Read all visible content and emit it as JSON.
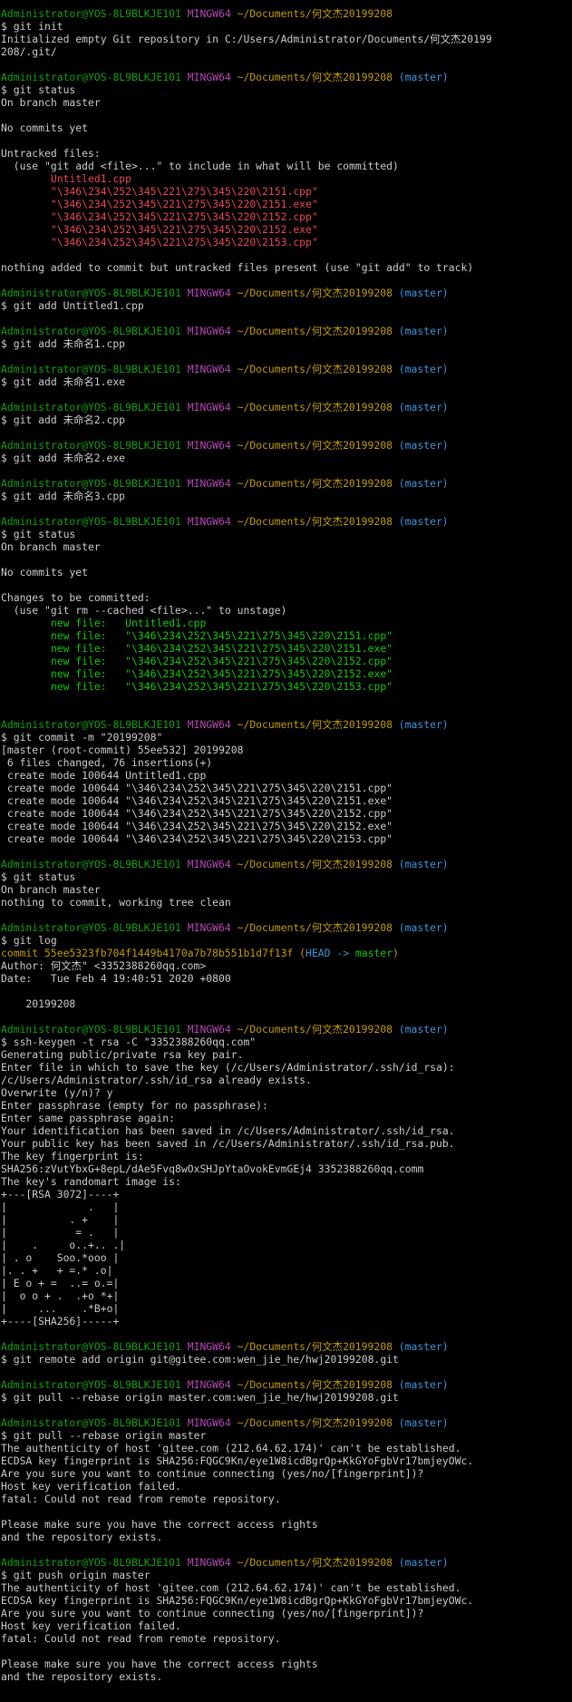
{
  "theme": {
    "background": "#000000",
    "text": "#cccccc",
    "user_host": "#13a10e",
    "mingw": "#b648b6",
    "path": "#c19c00",
    "branch": "#3a96dd",
    "untracked": "#e74856",
    "staged": "#16c60c"
  },
  "lines": [
    [
      [
        "Administrator@YOS-8L9BLKJE101",
        "user"
      ],
      [
        " ",
        "text"
      ],
      [
        "MINGW64",
        "mingw"
      ],
      [
        " ",
        "text"
      ],
      [
        "~/Documents/何文杰20199208",
        "path"
      ]
    ],
    [
      [
        "$ git init",
        "text"
      ]
    ],
    [
      [
        "Initialized empty Git repository in C:/Users/Administrator/Documents/何文杰20199",
        "text"
      ]
    ],
    [
      [
        "208/.git/",
        "text"
      ]
    ],
    [
      [
        "",
        "text"
      ]
    ],
    [
      [
        "Administrator@YOS-8L9BLKJE101",
        "user"
      ],
      [
        " ",
        "text"
      ],
      [
        "MINGW64",
        "mingw"
      ],
      [
        " ",
        "text"
      ],
      [
        "~/Documents/何文杰20199208",
        "path"
      ],
      [
        " ",
        "text"
      ],
      [
        "(master)",
        "branch"
      ]
    ],
    [
      [
        "$ git status",
        "text"
      ]
    ],
    [
      [
        "On branch master",
        "text"
      ]
    ],
    [
      [
        "",
        "text"
      ]
    ],
    [
      [
        "No commits yet",
        "text"
      ]
    ],
    [
      [
        "",
        "text"
      ]
    ],
    [
      [
        "Untracked files:",
        "text"
      ]
    ],
    [
      [
        "  (use \"git add <file>...\" to include in what will be committed)",
        "text"
      ]
    ],
    [
      [
        "        ",
        "text"
      ],
      [
        "Untitled1.cpp",
        "red"
      ]
    ],
    [
      [
        "        ",
        "text"
      ],
      [
        "\"\\346\\234\\252\\345\\221\\275\\345\\220\\2151.cpp\"",
        "red"
      ]
    ],
    [
      [
        "        ",
        "text"
      ],
      [
        "\"\\346\\234\\252\\345\\221\\275\\345\\220\\2151.exe\"",
        "red"
      ]
    ],
    [
      [
        "        ",
        "text"
      ],
      [
        "\"\\346\\234\\252\\345\\221\\275\\345\\220\\2152.cpp\"",
        "red"
      ]
    ],
    [
      [
        "        ",
        "text"
      ],
      [
        "\"\\346\\234\\252\\345\\221\\275\\345\\220\\2152.exe\"",
        "red"
      ]
    ],
    [
      [
        "        ",
        "text"
      ],
      [
        "\"\\346\\234\\252\\345\\221\\275\\345\\220\\2153.cpp\"",
        "red"
      ]
    ],
    [
      [
        "",
        "text"
      ]
    ],
    [
      [
        "nothing added to commit but untracked files present (use \"git add\" to track)",
        "text"
      ]
    ],
    [
      [
        "",
        "text"
      ]
    ],
    [
      [
        "Administrator@YOS-8L9BLKJE101",
        "user"
      ],
      [
        " ",
        "text"
      ],
      [
        "MINGW64",
        "mingw"
      ],
      [
        " ",
        "text"
      ],
      [
        "~/Documents/何文杰20199208",
        "path"
      ],
      [
        " ",
        "text"
      ],
      [
        "(master)",
        "branch"
      ]
    ],
    [
      [
        "$ git add Untitled1.cpp",
        "text"
      ]
    ],
    [
      [
        "",
        "text"
      ]
    ],
    [
      [
        "Administrator@YOS-8L9BLKJE101",
        "user"
      ],
      [
        " ",
        "text"
      ],
      [
        "MINGW64",
        "mingw"
      ],
      [
        " ",
        "text"
      ],
      [
        "~/Documents/何文杰20199208",
        "path"
      ],
      [
        " ",
        "text"
      ],
      [
        "(master)",
        "branch"
      ]
    ],
    [
      [
        "$ git add 未命名1.cpp",
        "text"
      ]
    ],
    [
      [
        "",
        "text"
      ]
    ],
    [
      [
        "Administrator@YOS-8L9BLKJE101",
        "user"
      ],
      [
        " ",
        "text"
      ],
      [
        "MINGW64",
        "mingw"
      ],
      [
        " ",
        "text"
      ],
      [
        "~/Documents/何文杰20199208",
        "path"
      ],
      [
        " ",
        "text"
      ],
      [
        "(master)",
        "branch"
      ]
    ],
    [
      [
        "$ git add 未命名1.exe",
        "text"
      ]
    ],
    [
      [
        "",
        "text"
      ]
    ],
    [
      [
        "Administrator@YOS-8L9BLKJE101",
        "user"
      ],
      [
        " ",
        "text"
      ],
      [
        "MINGW64",
        "mingw"
      ],
      [
        " ",
        "text"
      ],
      [
        "~/Documents/何文杰20199208",
        "path"
      ],
      [
        " ",
        "text"
      ],
      [
        "(master)",
        "branch"
      ]
    ],
    [
      [
        "$ git add 未命名2.cpp",
        "text"
      ]
    ],
    [
      [
        "",
        "text"
      ]
    ],
    [
      [
        "Administrator@YOS-8L9BLKJE101",
        "user"
      ],
      [
        " ",
        "text"
      ],
      [
        "MINGW64",
        "mingw"
      ],
      [
        " ",
        "text"
      ],
      [
        "~/Documents/何文杰20199208",
        "path"
      ],
      [
        " ",
        "text"
      ],
      [
        "(master)",
        "branch"
      ]
    ],
    [
      [
        "$ git add 未命名2.exe",
        "text"
      ]
    ],
    [
      [
        "",
        "text"
      ]
    ],
    [
      [
        "Administrator@YOS-8L9BLKJE101",
        "user"
      ],
      [
        " ",
        "text"
      ],
      [
        "MINGW64",
        "mingw"
      ],
      [
        " ",
        "text"
      ],
      [
        "~/Documents/何文杰20199208",
        "path"
      ],
      [
        " ",
        "text"
      ],
      [
        "(master)",
        "branch"
      ]
    ],
    [
      [
        "$ git add 未命名3.cpp",
        "text"
      ]
    ],
    [
      [
        "",
        "text"
      ]
    ],
    [
      [
        "Administrator@YOS-8L9BLKJE101",
        "user"
      ],
      [
        " ",
        "text"
      ],
      [
        "MINGW64",
        "mingw"
      ],
      [
        " ",
        "text"
      ],
      [
        "~/Documents/何文杰20199208",
        "path"
      ],
      [
        " ",
        "text"
      ],
      [
        "(master)",
        "branch"
      ]
    ],
    [
      [
        "$ git status",
        "text"
      ]
    ],
    [
      [
        "On branch master",
        "text"
      ]
    ],
    [
      [
        "",
        "text"
      ]
    ],
    [
      [
        "No commits yet",
        "text"
      ]
    ],
    [
      [
        "",
        "text"
      ]
    ],
    [
      [
        "Changes to be committed:",
        "text"
      ]
    ],
    [
      [
        "  (use \"git rm --cached <file>...\" to unstage)",
        "text"
      ]
    ],
    [
      [
        "        ",
        "text"
      ],
      [
        "new file:   Untitled1.cpp",
        "green"
      ]
    ],
    [
      [
        "        ",
        "text"
      ],
      [
        "new file:   \"\\346\\234\\252\\345\\221\\275\\345\\220\\2151.cpp\"",
        "green"
      ]
    ],
    [
      [
        "        ",
        "text"
      ],
      [
        "new file:   \"\\346\\234\\252\\345\\221\\275\\345\\220\\2151.exe\"",
        "green"
      ]
    ],
    [
      [
        "        ",
        "text"
      ],
      [
        "new file:   \"\\346\\234\\252\\345\\221\\275\\345\\220\\2152.cpp\"",
        "green"
      ]
    ],
    [
      [
        "        ",
        "text"
      ],
      [
        "new file:   \"\\346\\234\\252\\345\\221\\275\\345\\220\\2152.exe\"",
        "green"
      ]
    ],
    [
      [
        "        ",
        "text"
      ],
      [
        "new file:   \"\\346\\234\\252\\345\\221\\275\\345\\220\\2153.cpp\"",
        "green"
      ]
    ],
    [
      [
        "",
        "text"
      ]
    ],
    [
      [
        "",
        "text"
      ]
    ],
    [
      [
        "Administrator@YOS-8L9BLKJE101",
        "user"
      ],
      [
        " ",
        "text"
      ],
      [
        "MINGW64",
        "mingw"
      ],
      [
        " ",
        "text"
      ],
      [
        "~/Documents/何文杰20199208",
        "path"
      ],
      [
        " ",
        "text"
      ],
      [
        "(master)",
        "branch"
      ]
    ],
    [
      [
        "$ git commit -m \"20199208\"",
        "text"
      ]
    ],
    [
      [
        "[master (root-commit) 55ee532] 20199208",
        "text"
      ]
    ],
    [
      [
        " 6 files changed, 76 insertions(+)",
        "text"
      ]
    ],
    [
      [
        " create mode 100644 Untitled1.cpp",
        "text"
      ]
    ],
    [
      [
        " create mode 100644 \"\\346\\234\\252\\345\\221\\275\\345\\220\\2151.cpp\"",
        "text"
      ]
    ],
    [
      [
        " create mode 100644 \"\\346\\234\\252\\345\\221\\275\\345\\220\\2151.exe\"",
        "text"
      ]
    ],
    [
      [
        " create mode 100644 \"\\346\\234\\252\\345\\221\\275\\345\\220\\2152.cpp\"",
        "text"
      ]
    ],
    [
      [
        " create mode 100644 \"\\346\\234\\252\\345\\221\\275\\345\\220\\2152.exe\"",
        "text"
      ]
    ],
    [
      [
        " create mode 100644 \"\\346\\234\\252\\345\\221\\275\\345\\220\\2153.cpp\"",
        "text"
      ]
    ],
    [
      [
        "",
        "text"
      ]
    ],
    [
      [
        "Administrator@YOS-8L9BLKJE101",
        "user"
      ],
      [
        " ",
        "text"
      ],
      [
        "MINGW64",
        "mingw"
      ],
      [
        " ",
        "text"
      ],
      [
        "~/Documents/何文杰20199208",
        "path"
      ],
      [
        " ",
        "text"
      ],
      [
        "(master)",
        "branch"
      ]
    ],
    [
      [
        "$ git status",
        "text"
      ]
    ],
    [
      [
        "On branch master",
        "text"
      ]
    ],
    [
      [
        "nothing to commit, working tree clean",
        "text"
      ]
    ],
    [
      [
        "",
        "text"
      ]
    ],
    [
      [
        "Administrator@YOS-8L9BLKJE101",
        "user"
      ],
      [
        " ",
        "text"
      ],
      [
        "MINGW64",
        "mingw"
      ],
      [
        " ",
        "text"
      ],
      [
        "~/Documents/何文杰20199208",
        "path"
      ],
      [
        " ",
        "text"
      ],
      [
        "(master)",
        "branch"
      ]
    ],
    [
      [
        "$ git log",
        "text"
      ]
    ],
    [
      [
        "commit 55ee5323fb704f1449b4170a7b78b551b1d7f13f",
        "yellow"
      ],
      [
        " (",
        "yellow"
      ],
      [
        "HEAD -> ",
        "cyan"
      ],
      [
        "master",
        "green"
      ],
      [
        ")",
        "yellow"
      ]
    ],
    [
      [
        "Author: 何文杰\" <3352388260qq.com>",
        "text"
      ]
    ],
    [
      [
        "Date:   Tue Feb 4 19:40:51 2020 +0800",
        "text"
      ]
    ],
    [
      [
        "",
        "text"
      ]
    ],
    [
      [
        "    20199208",
        "text"
      ]
    ],
    [
      [
        "",
        "text"
      ]
    ],
    [
      [
        "Administrator@YOS-8L9BLKJE101",
        "user"
      ],
      [
        " ",
        "text"
      ],
      [
        "MINGW64",
        "mingw"
      ],
      [
        " ",
        "text"
      ],
      [
        "~/Documents/何文杰20199208",
        "path"
      ],
      [
        " ",
        "text"
      ],
      [
        "(master)",
        "branch"
      ]
    ],
    [
      [
        "$ ssh-keygen -t rsa -C \"3352388260qq.com\"",
        "text"
      ]
    ],
    [
      [
        "Generating public/private rsa key pair.",
        "text"
      ]
    ],
    [
      [
        "Enter file in which to save the key (/c/Users/Administrator/.ssh/id_rsa):",
        "text"
      ]
    ],
    [
      [
        "/c/Users/Administrator/.ssh/id_rsa already exists.",
        "text"
      ]
    ],
    [
      [
        "Overwrite (y/n)? y",
        "text"
      ]
    ],
    [
      [
        "Enter passphrase (empty for no passphrase):",
        "text"
      ]
    ],
    [
      [
        "Enter same passphrase again:",
        "text"
      ]
    ],
    [
      [
        "Your identification has been saved in /c/Users/Administrator/.ssh/id_rsa.",
        "text"
      ]
    ],
    [
      [
        "Your public key has been saved in /c/Users/Administrator/.ssh/id_rsa.pub.",
        "text"
      ]
    ],
    [
      [
        "The key fingerprint is:",
        "text"
      ]
    ],
    [
      [
        "SHA256:zVutYbxG+8epL/dAe5Fvq8wOxSHJpYtaOvokEvmGEj4 3352388260qq.comm",
        "text"
      ]
    ],
    [
      [
        "The key's randomart image is:",
        "text"
      ]
    ],
    [
      [
        "+---[RSA 3072]----+",
        "text"
      ]
    ],
    [
      [
        "|             .   |",
        "text"
      ]
    ],
    [
      [
        "|          . +    |",
        "text"
      ]
    ],
    [
      [
        "|           = .   |",
        "text"
      ]
    ],
    [
      [
        "|    .     o..+.. .|",
        "text"
      ]
    ],
    [
      [
        "| . o    Soo.*ooo |",
        "text"
      ]
    ],
    [
      [
        "|. . +   + =.* .o|",
        "text"
      ]
    ],
    [
      [
        "| E o + =  ..= o.=|",
        "text"
      ]
    ],
    [
      [
        "|  o o + .  .+o *+|",
        "text"
      ]
    ],
    [
      [
        "|     ...    .*B+o|",
        "text"
      ]
    ],
    [
      [
        "+----[SHA256]-----+",
        "text"
      ]
    ],
    [
      [
        "",
        "text"
      ]
    ],
    [
      [
        "Administrator@YOS-8L9BLKJE101",
        "user"
      ],
      [
        " ",
        "text"
      ],
      [
        "MINGW64",
        "mingw"
      ],
      [
        " ",
        "text"
      ],
      [
        "~/Documents/何文杰20199208",
        "path"
      ],
      [
        " ",
        "text"
      ],
      [
        "(master)",
        "branch"
      ]
    ],
    [
      [
        "$ git remote add origin git@gitee.com:wen_jie_he/hwj20199208.git",
        "text"
      ]
    ],
    [
      [
        "",
        "text"
      ]
    ],
    [
      [
        "Administrator@YOS-8L9BLKJE101",
        "user"
      ],
      [
        " ",
        "text"
      ],
      [
        "MINGW64",
        "mingw"
      ],
      [
        " ",
        "text"
      ],
      [
        "~/Documents/何文杰20199208",
        "path"
      ],
      [
        " ",
        "text"
      ],
      [
        "(master)",
        "branch"
      ]
    ],
    [
      [
        "$ git pull --rebase origin master.com:wen_jie_he/hwj20199208.git",
        "text"
      ]
    ],
    [
      [
        "",
        "text"
      ]
    ],
    [
      [
        "Administrator@YOS-8L9BLKJE101",
        "user"
      ],
      [
        " ",
        "text"
      ],
      [
        "MINGW64",
        "mingw"
      ],
      [
        " ",
        "text"
      ],
      [
        "~/Documents/何文杰20199208",
        "path"
      ],
      [
        " ",
        "text"
      ],
      [
        "(master)",
        "branch"
      ]
    ],
    [
      [
        "$ git pull --rebase origin master",
        "text"
      ]
    ],
    [
      [
        "The authenticity of host 'gitee.com (212.64.62.174)' can't be established.",
        "text"
      ]
    ],
    [
      [
        "ECDSA key fingerprint is SHA256:FQGC9Kn/eye1W8icdBgrQp+KkGYoFgbVr17bmjeyOWc.",
        "text"
      ]
    ],
    [
      [
        "Are you sure you want to continue connecting (yes/no/[fingerprint])?",
        "text"
      ]
    ],
    [
      [
        "Host key verification failed.",
        "text"
      ]
    ],
    [
      [
        "fatal: Could not read from remote repository.",
        "text"
      ]
    ],
    [
      [
        "",
        "text"
      ]
    ],
    [
      [
        "Please make sure you have the correct access rights",
        "text"
      ]
    ],
    [
      [
        "and the repository exists.",
        "text"
      ]
    ],
    [
      [
        "",
        "text"
      ]
    ],
    [
      [
        "Administrator@YOS-8L9BLKJE101",
        "user"
      ],
      [
        " ",
        "text"
      ],
      [
        "MINGW64",
        "mingw"
      ],
      [
        " ",
        "text"
      ],
      [
        "~/Documents/何文杰20199208",
        "path"
      ],
      [
        " ",
        "text"
      ],
      [
        "(master)",
        "branch"
      ]
    ],
    [
      [
        "$ git push origin master",
        "text"
      ]
    ],
    [
      [
        "The authenticity of host 'gitee.com (212.64.62.174)' can't be established.",
        "text"
      ]
    ],
    [
      [
        "ECDSA key fingerprint is SHA256:FQGC9Kn/eye1W8icdBgrQp+KkGYoFgbVr17bmjeyOWc.",
        "text"
      ]
    ],
    [
      [
        "Are you sure you want to continue connecting (yes/no/[fingerprint])?",
        "text"
      ]
    ],
    [
      [
        "Host key verification failed.",
        "text"
      ]
    ],
    [
      [
        "fatal: Could not read from remote repository.",
        "text"
      ]
    ],
    [
      [
        "",
        "text"
      ]
    ],
    [
      [
        "Please make sure you have the correct access rights",
        "text"
      ]
    ],
    [
      [
        "and the repository exists.",
        "text"
      ]
    ]
  ]
}
